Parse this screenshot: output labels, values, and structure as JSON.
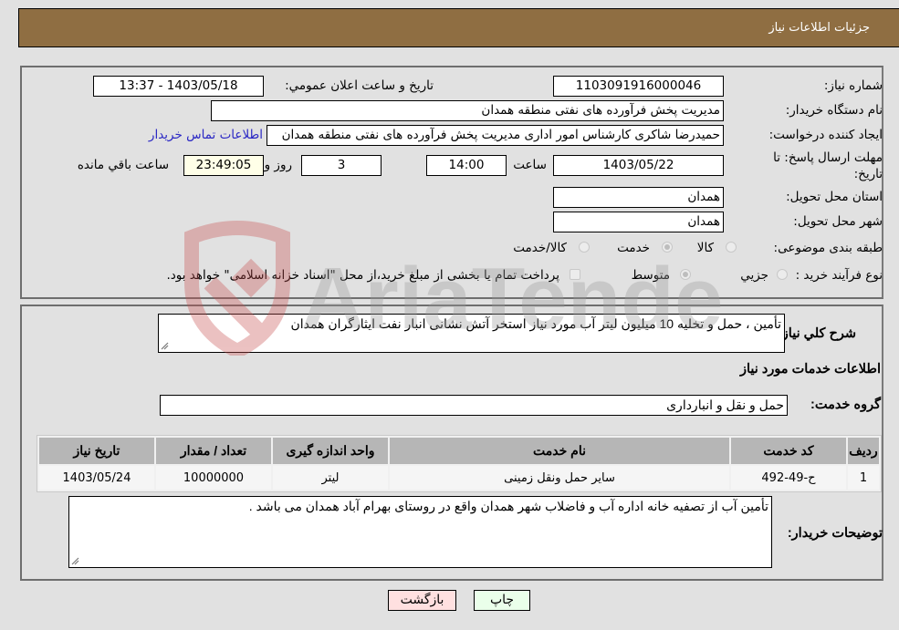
{
  "header": {
    "title": "جزئیات اطلاعات نیاز"
  },
  "details": {
    "need_number": {
      "label": "شماره نیاز:",
      "value": "1103091916000046"
    },
    "announce_datetime": {
      "label": "تاریخ و ساعت اعلان عمومي:",
      "value": "1403/05/18 - 13:37"
    },
    "buyer_org": {
      "label": "نام دستگاه خريدار:",
      "value": "مديريت پخش فرآورده هاى نفتى منطقه همدان"
    },
    "requester": {
      "label": "ایجاد کننده درخواست:",
      "value": "حميدرضا شاكرى كارشناس امور ادارى مديريت پخش فرآورده هاى نفتى منطقه همدان"
    },
    "buyer_contact_link": "اطلاعات تماس خریدار",
    "deadline": {
      "label": "مهلت ارسال پاسخ: تا تاریخ:",
      "date": "1403/05/22",
      "time_label": "ساعت",
      "time": "14:00",
      "days": "3",
      "days_label": "روز و",
      "remaining": "23:49:05",
      "remaining_label": "ساعت باقي مانده"
    },
    "province": {
      "label": "استان محل تحویل:",
      "value": "همدان"
    },
    "city": {
      "label": "شهر محل تحویل:",
      "value": "همدان"
    },
    "category": {
      "label": "طبقه بندی موضوعی:",
      "options": [
        {
          "label": "کالا",
          "checked": false
        },
        {
          "label": "خدمت",
          "checked": true
        },
        {
          "label": "کالا/خدمت",
          "checked": false
        }
      ]
    },
    "purchase_type": {
      "label": "نوع فرآیند خرید :",
      "options": [
        {
          "label": "جزيي",
          "checked": false
        },
        {
          "label": "متوسط",
          "checked": true
        }
      ],
      "treasury_note": "پرداخت تمام یا بخشی از مبلغ خرید،از محل \"اسناد خزانه اسلامی\" خواهد بود."
    }
  },
  "general_description": {
    "label": "شرح کلي نياز:",
    "value": "تأمین ، حمل و تخلیه 10 میلیون لیتر آب مورد نیاز استخر آتش نشانی انبار نفت ایثارگران همدان"
  },
  "services_section": {
    "title": "اطلاعات خدمات مورد نياز",
    "group_label": "گروه خدمت:",
    "group_value": "حمل و نقل و انبارداری",
    "table": {
      "columns": [
        "رديف",
        "کد خدمت",
        "نام خدمت",
        "واحد اندازه گيری",
        "تعداد / مقدار",
        "تاريخ نياز"
      ],
      "rows": [
        [
          "1",
          "ح-49-492",
          "سایر حمل ونقل زمینی",
          "لیتر",
          "10000000",
          "1403/05/24"
        ]
      ]
    }
  },
  "buyer_notes": {
    "label": "توضيحات خريدار:",
    "value": "تأمین آب از تصفیه خانه اداره آب و فاضلاب شهر همدان واقع در روستای بهرام آباد همدان می باشد ."
  },
  "buttons": {
    "print": "چاپ",
    "back": "بازگشت"
  },
  "colors": {
    "header_bg": "#8f6e42",
    "print_bg": "#eaffea",
    "back_bg": "#ffe0e0",
    "link": "#2a27c4"
  },
  "watermark": {
    "text": "AriaTender.neT"
  }
}
